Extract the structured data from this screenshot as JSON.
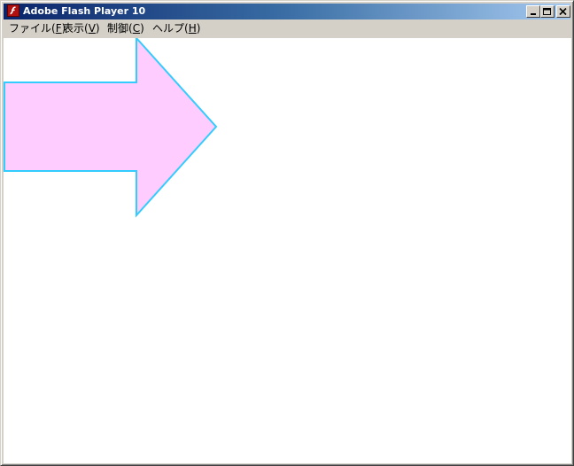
{
  "window": {
    "title": "Adobe Flash Player 10",
    "app_icon": "flash-icon",
    "controls": {
      "minimize_icon": "minimize-icon",
      "maximize_icon": "maximize-icon",
      "close_icon": "close-icon"
    }
  },
  "menubar": {
    "items": [
      {
        "base": "ファイル(",
        "mnemonic": "F",
        "tail": ")"
      },
      {
        "base": "表示(",
        "mnemonic": "V",
        "tail": ")"
      },
      {
        "base": "制御(",
        "mnemonic": "C",
        "tail": ")"
      },
      {
        "base": "ヘルプ(",
        "mnemonic": "H",
        "tail": ")"
      }
    ]
  },
  "stage": {
    "background": "#ffffff",
    "shape": {
      "kind": "arrow-right",
      "fill": "#ffccff",
      "stroke": "#33ccff"
    }
  },
  "colors": {
    "titlebar_start": "#0a246a",
    "titlebar_end": "#a6caf0",
    "chrome": "#d4d0c8"
  }
}
